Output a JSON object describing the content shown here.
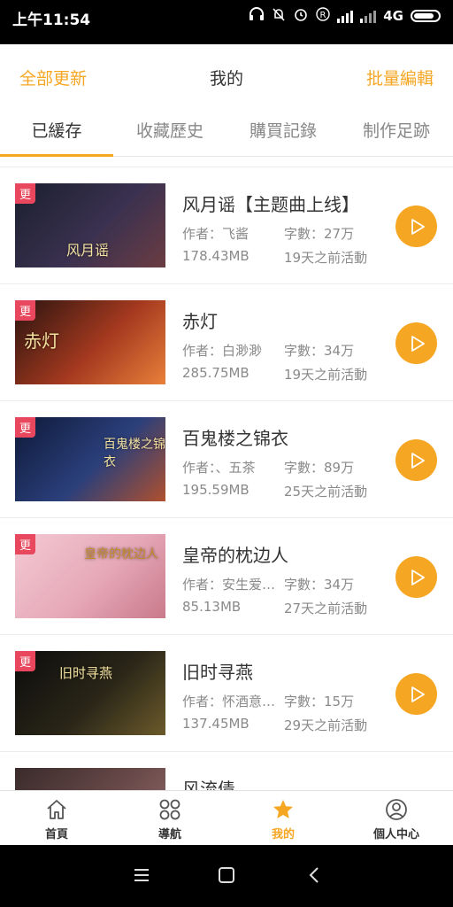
{
  "status": {
    "time": "上午11:54",
    "net": "4G"
  },
  "header": {
    "left_action": "全部更新",
    "title": "我的",
    "right_action": "批量編輯"
  },
  "tabs": [
    {
      "label": "已緩存",
      "active": true
    },
    {
      "label": "收藏歷史"
    },
    {
      "label": "購買記錄"
    },
    {
      "label": "制作足跡"
    }
  ],
  "items": [
    {
      "badge": "更",
      "cover_text": "风月谣",
      "title": "风月谣【主题曲上线】",
      "author": "作者：飞酱",
      "words": "字數：27万",
      "size": "178.43MB",
      "activity": "19天之前活動",
      "cover_colors": [
        "#1b1f2e",
        "#3a3150",
        "#6b3c42"
      ]
    },
    {
      "badge": "更",
      "cover_text": "赤灯",
      "title": "赤灯",
      "author": "作者：白渺渺",
      "words": "字數：34万",
      "size": "285.75MB",
      "activity": "19天之前活動",
      "cover_colors": [
        "#2a1410",
        "#a4391f",
        "#e8803a"
      ]
    },
    {
      "badge": "更",
      "cover_text": "百鬼楼之锦衣",
      "title": "百鬼楼之锦衣",
      "author": "作者：、五茶",
      "words": "字數：89万",
      "size": "195.59MB",
      "activity": "25天之前活動",
      "cover_colors": [
        "#0e1a3a",
        "#2b3f7a",
        "#b0502e"
      ]
    },
    {
      "badge": "更",
      "cover_text": "皇帝的枕边人",
      "title": "皇帝的枕边人",
      "author": "作者：安生爱…",
      "words": "字數：34万",
      "size": "85.13MB",
      "activity": "27天之前活動",
      "cover_colors": [
        "#f3c9d3",
        "#e6a8b8",
        "#c97a8a"
      ]
    },
    {
      "badge": "更",
      "cover_text": "旧时寻燕",
      "title": "旧时寻燕",
      "author": "作者：怀酒意…",
      "words": "字數：15万",
      "size": "137.45MB",
      "activity": "29天之前活動",
      "cover_colors": [
        "#0c0c0c",
        "#2a2618",
        "#6b5a2a"
      ]
    },
    {
      "badge": "",
      "cover_text": "",
      "title": "风流债",
      "author": "",
      "words": "",
      "size": "",
      "activity": "",
      "cover_colors": [
        "#3a2b2b",
        "#6a4a4a",
        "#9a7070"
      ]
    }
  ],
  "bottom_nav": [
    {
      "label": "首頁",
      "icon": "home-icon"
    },
    {
      "label": "導航",
      "icon": "grid-icon"
    },
    {
      "label": "我的",
      "icon": "star-icon",
      "active": true
    },
    {
      "label": "個人中心",
      "icon": "person-icon"
    }
  ],
  "colors": {
    "accent": "#f5a623",
    "badge": "#e8475d"
  }
}
